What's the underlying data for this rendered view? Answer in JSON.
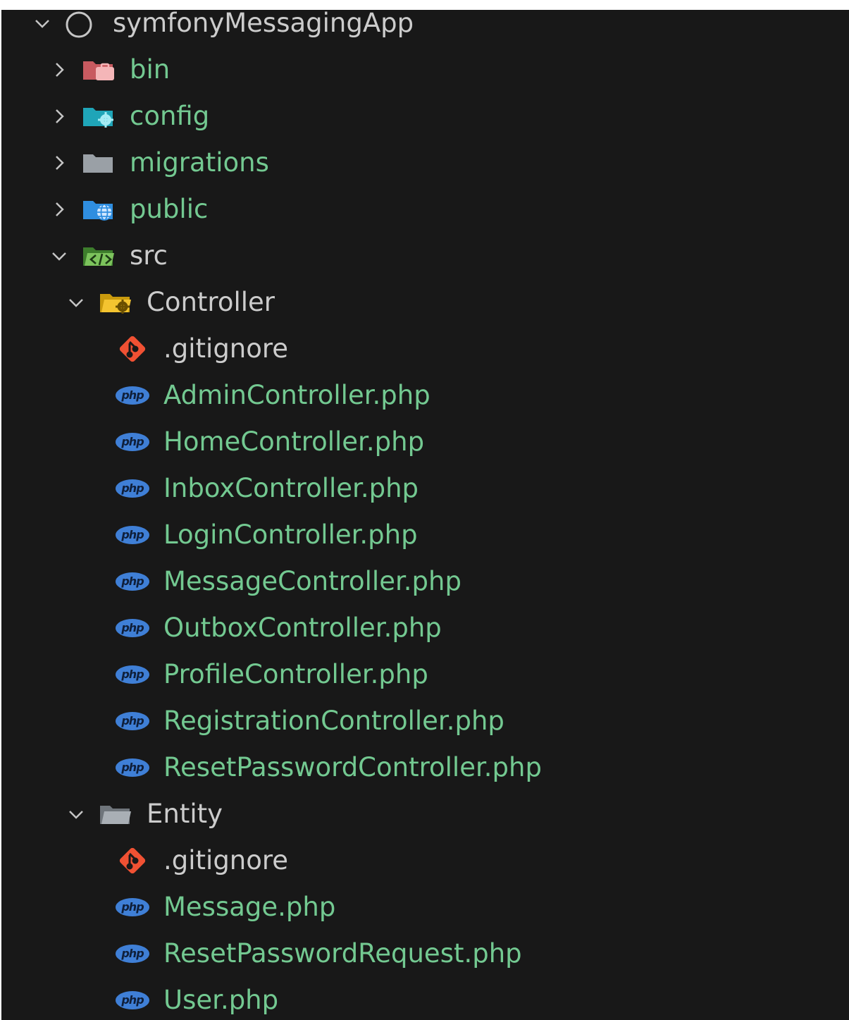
{
  "root": {
    "label": "symfonyMessagingApp",
    "expanded": true
  },
  "folders": [
    {
      "label": "bin",
      "expanded": false,
      "icon": "bin-folder-icon",
      "color": "#e46a6f"
    },
    {
      "label": "config",
      "expanded": false,
      "icon": "config-folder-icon",
      "color": "#1fa5b8"
    },
    {
      "label": "migrations",
      "expanded": false,
      "icon": "folder-icon",
      "color": "#9aa0a6"
    },
    {
      "label": "public",
      "expanded": false,
      "icon": "public-folder-icon",
      "color": "#2f8ee0"
    },
    {
      "label": "src",
      "expanded": true,
      "icon": "src-folder-icon",
      "color": "#5aa83a"
    }
  ],
  "controller": {
    "label": "Controller",
    "expanded": true,
    "icon": "controller-folder-icon",
    "color": "#e7b816",
    "files": [
      {
        "label": ".gitignore",
        "icon": "git-icon"
      },
      {
        "label": "AdminController.php",
        "icon": "php-icon"
      },
      {
        "label": "HomeController.php",
        "icon": "php-icon"
      },
      {
        "label": "InboxController.php",
        "icon": "php-icon"
      },
      {
        "label": "LoginController.php",
        "icon": "php-icon"
      },
      {
        "label": "MessageController.php",
        "icon": "php-icon"
      },
      {
        "label": "OutboxController.php",
        "icon": "php-icon"
      },
      {
        "label": "ProfileController.php",
        "icon": "php-icon"
      },
      {
        "label": "RegistrationController.php",
        "icon": "php-icon"
      },
      {
        "label": "ResetPasswordController.php",
        "icon": "php-icon"
      }
    ]
  },
  "entity": {
    "label": "Entity",
    "expanded": true,
    "icon": "open-folder-icon",
    "color": "#9aa0a6",
    "files": [
      {
        "label": ".gitignore",
        "icon": "git-icon"
      },
      {
        "label": "Message.php",
        "icon": "php-icon"
      },
      {
        "label": "ResetPasswordRequest.php",
        "icon": "php-icon"
      },
      {
        "label": "User.php",
        "icon": "php-icon"
      }
    ]
  },
  "colors": {
    "background": "#181818",
    "label_default": "#cccccc",
    "label_untracked": "#73c991",
    "php_badge": "#3f7fd6",
    "git_icon": "#f05133"
  },
  "php_badge_text": "php"
}
